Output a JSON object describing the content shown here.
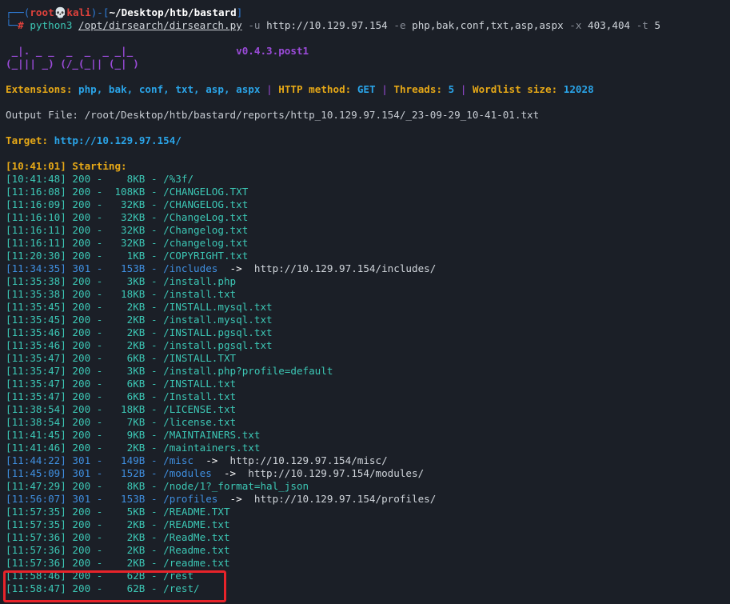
{
  "prompt": {
    "top_open": "┌──(",
    "user": "root",
    "skull": "💀",
    "host": "kali",
    "top_mid": ")-[",
    "cwd": "~/Desktop/htb/bastard",
    "top_close": "]",
    "bottom": "└─",
    "hash": "#",
    "cmd": "python3",
    "script": "/opt/dirsearch/dirsearch.py",
    "flag_u": "-u",
    "url": "http://10.129.97.154",
    "flag_e": "-e",
    "exts": "php,bak,conf,txt,asp,aspx",
    "flag_x": "-x",
    "excl": "403,404",
    "flag_t": "-t",
    "threads": "5"
  },
  "banner": {
    "art_line1": " _|. _ _  _  _  _ _|_",
    "art_line2": "(_||| _) (/_(_|| (_| )",
    "version": "v0.4.3.post1"
  },
  "config": {
    "ext_label": "Extensions:",
    "ext_value": "php, bak, conf, txt, asp, aspx",
    "sep": "|",
    "method_label": "HTTP method:",
    "method_value": "GET",
    "threads_label": "Threads:",
    "threads_value": "5",
    "wordlist_label": "Wordlist size:",
    "wordlist_value": "12028"
  },
  "output_file": "Output File: /root/Desktop/htb/bastard/reports/http_10.129.97.154/_23-09-29_10-41-01.txt",
  "target": {
    "label": "Target:",
    "value": "http://10.129.97.154/"
  },
  "starting": "[10:41:01] Starting:",
  "results": [
    {
      "time": "[10:41:48]",
      "code": "200",
      "size": "8KB",
      "path": "/%3f/",
      "redirect": ""
    },
    {
      "time": "[11:16:08]",
      "code": "200",
      "size": "108KB",
      "path": "/CHANGELOG.TXT",
      "redirect": ""
    },
    {
      "time": "[11:16:09]",
      "code": "200",
      "size": "32KB",
      "path": "/CHANGELOG.txt",
      "redirect": ""
    },
    {
      "time": "[11:16:10]",
      "code": "200",
      "size": "32KB",
      "path": "/ChangeLog.txt",
      "redirect": ""
    },
    {
      "time": "[11:16:11]",
      "code": "200",
      "size": "32KB",
      "path": "/Changelog.txt",
      "redirect": ""
    },
    {
      "time": "[11:16:11]",
      "code": "200",
      "size": "32KB",
      "path": "/changelog.txt",
      "redirect": ""
    },
    {
      "time": "[11:20:30]",
      "code": "200",
      "size": "1KB",
      "path": "/COPYRIGHT.txt",
      "redirect": ""
    },
    {
      "time": "[11:34:35]",
      "code": "301",
      "size": "153B",
      "path": "/includes",
      "redirect": "http://10.129.97.154/includes/"
    },
    {
      "time": "[11:35:38]",
      "code": "200",
      "size": "3KB",
      "path": "/install.php",
      "redirect": ""
    },
    {
      "time": "[11:35:38]",
      "code": "200",
      "size": "18KB",
      "path": "/install.txt",
      "redirect": ""
    },
    {
      "time": "[11:35:45]",
      "code": "200",
      "size": "2KB",
      "path": "/INSTALL.mysql.txt",
      "redirect": ""
    },
    {
      "time": "[11:35:45]",
      "code": "200",
      "size": "2KB",
      "path": "/install.mysql.txt",
      "redirect": ""
    },
    {
      "time": "[11:35:46]",
      "code": "200",
      "size": "2KB",
      "path": "/INSTALL.pgsql.txt",
      "redirect": ""
    },
    {
      "time": "[11:35:46]",
      "code": "200",
      "size": "2KB",
      "path": "/install.pgsql.txt",
      "redirect": ""
    },
    {
      "time": "[11:35:47]",
      "code": "200",
      "size": "6KB",
      "path": "/INSTALL.TXT",
      "redirect": ""
    },
    {
      "time": "[11:35:47]",
      "code": "200",
      "size": "3KB",
      "path": "/install.php?profile=default",
      "redirect": ""
    },
    {
      "time": "[11:35:47]",
      "code": "200",
      "size": "6KB",
      "path": "/INSTALL.txt",
      "redirect": ""
    },
    {
      "time": "[11:35:47]",
      "code": "200",
      "size": "6KB",
      "path": "/Install.txt",
      "redirect": ""
    },
    {
      "time": "[11:38:54]",
      "code": "200",
      "size": "18KB",
      "path": "/LICENSE.txt",
      "redirect": ""
    },
    {
      "time": "[11:38:54]",
      "code": "200",
      "size": "7KB",
      "path": "/license.txt",
      "redirect": ""
    },
    {
      "time": "[11:41:45]",
      "code": "200",
      "size": "9KB",
      "path": "/MAINTAINERS.txt",
      "redirect": ""
    },
    {
      "time": "[11:41:46]",
      "code": "200",
      "size": "2KB",
      "path": "/maintainers.txt",
      "redirect": ""
    },
    {
      "time": "[11:44:22]",
      "code": "301",
      "size": "149B",
      "path": "/misc",
      "redirect": "http://10.129.97.154/misc/"
    },
    {
      "time": "[11:45:09]",
      "code": "301",
      "size": "152B",
      "path": "/modules",
      "redirect": "http://10.129.97.154/modules/"
    },
    {
      "time": "[11:47:29]",
      "code": "200",
      "size": "8KB",
      "path": "/node/1?_format=hal_json",
      "redirect": ""
    },
    {
      "time": "[11:56:07]",
      "code": "301",
      "size": "153B",
      "path": "/profiles",
      "redirect": "http://10.129.97.154/profiles/"
    },
    {
      "time": "[11:57:35]",
      "code": "200",
      "size": "5KB",
      "path": "/README.TXT",
      "redirect": ""
    },
    {
      "time": "[11:57:35]",
      "code": "200",
      "size": "2KB",
      "path": "/README.txt",
      "redirect": ""
    },
    {
      "time": "[11:57:36]",
      "code": "200",
      "size": "2KB",
      "path": "/ReadMe.txt",
      "redirect": ""
    },
    {
      "time": "[11:57:36]",
      "code": "200",
      "size": "2KB",
      "path": "/Readme.txt",
      "redirect": ""
    },
    {
      "time": "[11:57:36]",
      "code": "200",
      "size": "2KB",
      "path": "/readme.txt",
      "redirect": ""
    },
    {
      "time": "[11:58:46]",
      "code": "200",
      "size": "62B",
      "path": "/rest",
      "redirect": ""
    },
    {
      "time": "[11:58:47]",
      "code": "200",
      "size": "62B",
      "path": "/rest/",
      "redirect": ""
    }
  ],
  "colors": {
    "background": "#1b1f27",
    "redirect_row": "#3f8fe0",
    "highlight_box": "#e8232a"
  }
}
